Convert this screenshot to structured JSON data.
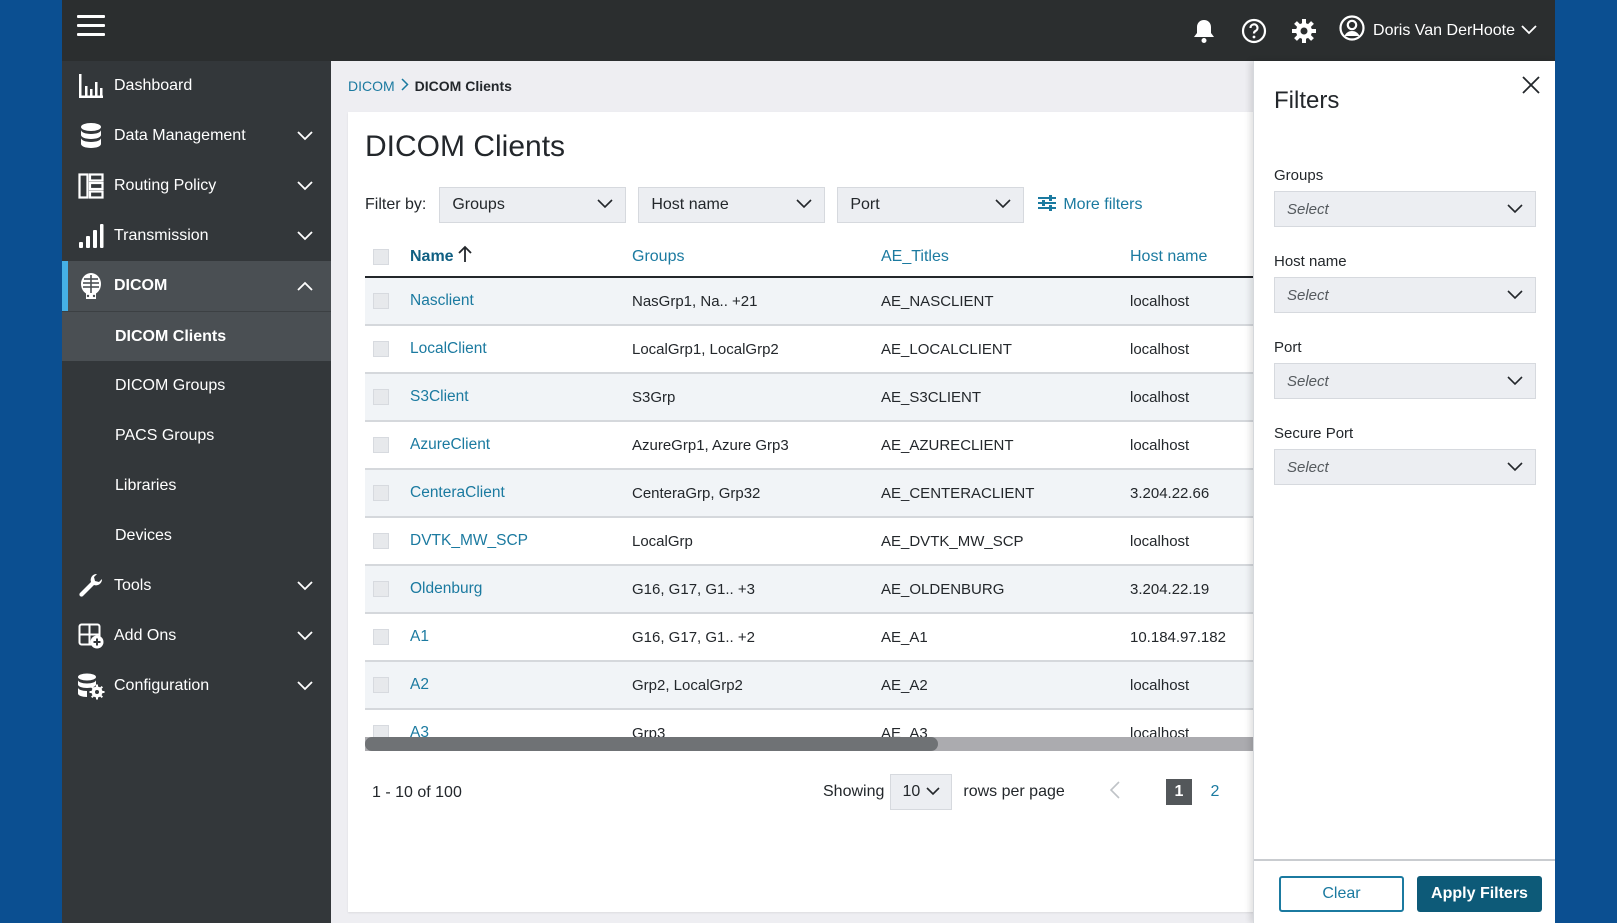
{
  "topbar": {
    "menu_icon": "hamburger-menu-icon",
    "icons": [
      "bell-icon",
      "help-icon",
      "gear-icon"
    ],
    "user_name": "Doris Van DerHoote"
  },
  "sidebar": {
    "items": [
      {
        "label": "Dashboard",
        "icon": "bar-chart-icon",
        "expandable": false
      },
      {
        "label": "Data Management",
        "icon": "database-icon",
        "expandable": true
      },
      {
        "label": "Routing Policy",
        "icon": "routing-icon",
        "expandable": true
      },
      {
        "label": "Transmission",
        "icon": "signal-bars-icon",
        "expandable": true
      },
      {
        "label": "DICOM",
        "icon": "dicom-skeleton-icon",
        "expandable": true,
        "expanded": true,
        "active": true
      },
      {
        "label": "Tools",
        "icon": "wrench-icon",
        "expandable": true
      },
      {
        "label": "Add Ons",
        "icon": "add-ons-icon",
        "expandable": true
      },
      {
        "label": "Configuration",
        "icon": "database-gear-icon",
        "expandable": true
      }
    ],
    "dicom_subitems": [
      {
        "label": "DICOM Clients",
        "current": true
      },
      {
        "label": "DICOM Groups"
      },
      {
        "label": "PACS Groups"
      },
      {
        "label": "Libraries"
      },
      {
        "label": "Devices"
      }
    ]
  },
  "breadcrumb": {
    "parent": "DICOM",
    "current": "DICOM Clients"
  },
  "main": {
    "title": "DICOM Clients",
    "filter_label": "Filter by:",
    "filters": [
      "Groups",
      "Host name",
      "Port"
    ],
    "more_filters": "More filters",
    "table": {
      "columns": [
        "Name",
        "Groups",
        "AE_Titles",
        "Host name"
      ],
      "sort_column": "Name",
      "sort_direction": "ascending",
      "rows": [
        {
          "name": "Nasclient",
          "groups": "NasGrp1, Na.. +21",
          "ae_title": "AE_NASCLIENT",
          "host": "localhost"
        },
        {
          "name": "LocalClient",
          "groups": "LocalGrp1, LocalGrp2",
          "ae_title": "AE_LOCALCLIENT",
          "host": "localhost"
        },
        {
          "name": "S3Client",
          "groups": "S3Grp",
          "ae_title": "AE_S3CLIENT",
          "host": "localhost"
        },
        {
          "name": "AzureClient",
          "groups": "AzureGrp1, Azure Grp3",
          "ae_title": "AE_AZURECLIENT",
          "host": "localhost"
        },
        {
          "name": "CenteraClient",
          "groups": "CenteraGrp, Grp32",
          "ae_title": "AE_CENTERACLIENT",
          "host": "3.204.22.66"
        },
        {
          "name": "DVTK_MW_SCP",
          "groups": "LocalGrp",
          "ae_title": "AE_DVTK_MW_SCP",
          "host": "localhost"
        },
        {
          "name": "Oldenburg",
          "groups": "G16, G17, G1.. +3",
          "ae_title": "AE_OLDENBURG",
          "host": "3.204.22.19"
        },
        {
          "name": "A1",
          "groups": "G16, G17, G1.. +2",
          "ae_title": "AE_A1",
          "host": "10.184.97.182"
        },
        {
          "name": "A2",
          "groups": "Grp2, LocalGrp2",
          "ae_title": "AE_A2",
          "host": "localhost"
        },
        {
          "name": "A3",
          "groups": "Grp3",
          "ae_title": "AE_A3",
          "host": "localhost"
        }
      ]
    },
    "pagination": {
      "range_text": "1 - 10 of 100",
      "showing_label": "Showing",
      "rows_per_page": "10",
      "rows_per_page_label": "rows per page",
      "current_page": "1",
      "next_page": "2"
    }
  },
  "filters_panel": {
    "title": "Filters",
    "fields": [
      {
        "label": "Groups",
        "placeholder": "Select"
      },
      {
        "label": "Host name",
        "placeholder": "Select"
      },
      {
        "label": "Port",
        "placeholder": "Select"
      },
      {
        "label": "Secure Port",
        "placeholder": "Select"
      }
    ],
    "clear_label": "Clear",
    "apply_label": "Apply Filters"
  },
  "colors": {
    "accent": "#1b7aa0",
    "primary_button": "#0d5a78",
    "sidebar_bg": "#33373a",
    "topbar_bg": "#2b2e2f",
    "active_indicator": "#45b0e6",
    "frame_bg": "#0b4f91"
  }
}
